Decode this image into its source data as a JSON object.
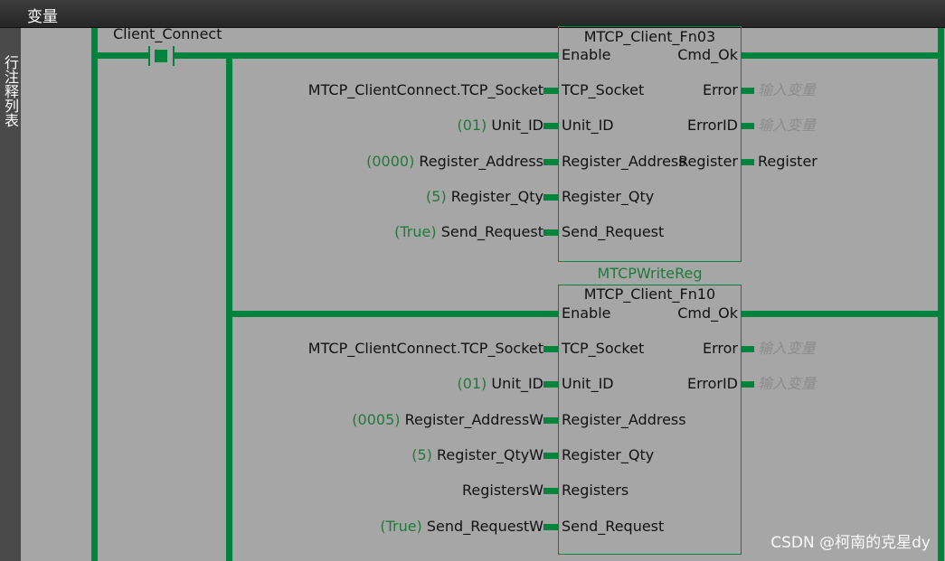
{
  "window": {
    "title": "变量"
  },
  "sidebar": {
    "tab_label": "行注释列表"
  },
  "rung": {
    "contact": {
      "name": "Client_Connect"
    }
  },
  "fb1": {
    "instance": "",
    "type": "MTCP_Client_Fn03",
    "inputs": [
      {
        "pin": "Enable",
        "const": "",
        "var": ""
      },
      {
        "pin": "TCP_Socket",
        "const": "",
        "var": "MTCP_ClientConnect.TCP_Socket"
      },
      {
        "pin": "Unit_ID",
        "const": "(01)",
        "var": "Unit_ID"
      },
      {
        "pin": "Register_Address",
        "const": "(0000)",
        "var": "Register_Address"
      },
      {
        "pin": "Register_Qty",
        "const": "(5)",
        "var": "Register_Qty"
      },
      {
        "pin": "Send_Request",
        "const": "(True)",
        "var": "Send_Request"
      }
    ],
    "outputs": [
      {
        "pin": "Cmd_Ok",
        "var": "",
        "placeholder": false
      },
      {
        "pin": "Error",
        "var": "输入变量",
        "placeholder": true
      },
      {
        "pin": "ErrorID",
        "var": "输入变量",
        "placeholder": true
      },
      {
        "pin": "Register",
        "var": "Register",
        "placeholder": false
      }
    ]
  },
  "fb2": {
    "instance": "MTCPWriteReg",
    "type": "MTCP_Client_Fn10",
    "inputs": [
      {
        "pin": "Enable",
        "const": "",
        "var": ""
      },
      {
        "pin": "TCP_Socket",
        "const": "",
        "var": "MTCP_ClientConnect.TCP_Socket"
      },
      {
        "pin": "Unit_ID",
        "const": "(01)",
        "var": "Unit_ID"
      },
      {
        "pin": "Register_Address",
        "const": "(0005)",
        "var": "Register_AddressW"
      },
      {
        "pin": "Register_Qty",
        "const": "(5)",
        "var": "Register_QtyW"
      },
      {
        "pin": "Registers",
        "const": "",
        "var": "RegistersW"
      },
      {
        "pin": "Send_Request",
        "const": "(True)",
        "var": "Send_RequestW"
      }
    ],
    "outputs": [
      {
        "pin": "Cmd_Ok",
        "var": "",
        "placeholder": false
      },
      {
        "pin": "Error",
        "var": "输入变量",
        "placeholder": true
      },
      {
        "pin": "ErrorID",
        "var": "输入变量",
        "placeholder": true
      }
    ]
  },
  "watermark": "CSDN @柯南的克星dy",
  "colors": {
    "wire": "#00843d",
    "constant": "#1f7a3a",
    "placeholder": "#8c8c8c",
    "background": "#a6a6a6"
  }
}
